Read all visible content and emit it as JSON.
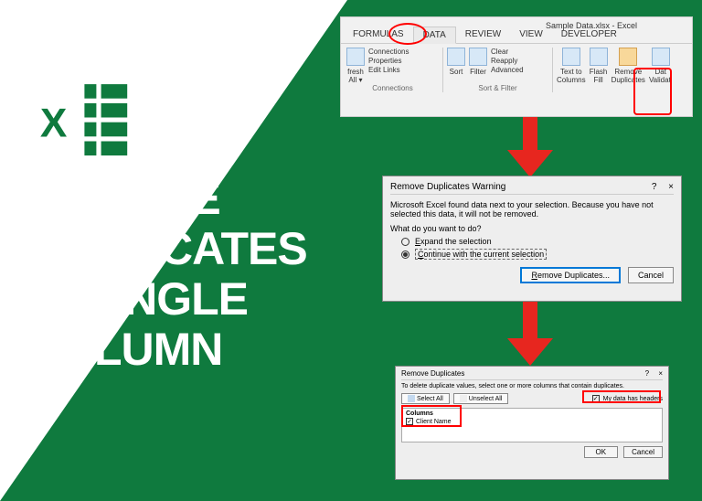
{
  "headline": {
    "line1": "REMOVE",
    "line2": "DUPLICATES",
    "line3": "IN SINGLE",
    "line4": "COLUMN"
  },
  "ribbon": {
    "window_title": "Sample Data.xlsx - Excel",
    "tabs": {
      "formulas": "FORMULAS",
      "data": "DATA",
      "review": "REVIEW",
      "view": "VIEW",
      "developer": "DEVELOPER"
    },
    "refresh": "fresh\nAll ▾",
    "connections": "Connections",
    "properties": "Properties",
    "edit_links": "Edit Links",
    "group_connections": "Connections",
    "sort": "Sort",
    "filter": "Filter",
    "clear": "Clear",
    "reapply": "Reapply",
    "advanced": "Advanced",
    "group_sort_filter": "Sort & Filter",
    "text_to_columns": "Text to\nColumns",
    "flash_fill": "Flash\nFill",
    "remove_duplicates": "Remove\nDuplicates",
    "data_validation": "Dat\nValidati"
  },
  "dialog1": {
    "title": "Remove Duplicates Warning",
    "help": "?",
    "close": "×",
    "body": "Microsoft Excel found data next to your selection. Because you have not selected this data, it will not be removed.",
    "question": "What do you want to do?",
    "option1": "Expand the selection",
    "option2": "Continue with the current selection",
    "btn_remove": "Remove Duplicates...",
    "btn_cancel": "Cancel"
  },
  "dialog2": {
    "title": "Remove Duplicates",
    "help": "?",
    "close": "×",
    "subtext": "To delete duplicate values, select one or more columns that contain duplicates.",
    "select_all": "Select All",
    "unselect_all": "Unselect All",
    "headers": "My data has headers",
    "columns_header": "Columns",
    "column_item": "Client Name",
    "btn_ok": "OK",
    "btn_cancel": "Cancel"
  }
}
